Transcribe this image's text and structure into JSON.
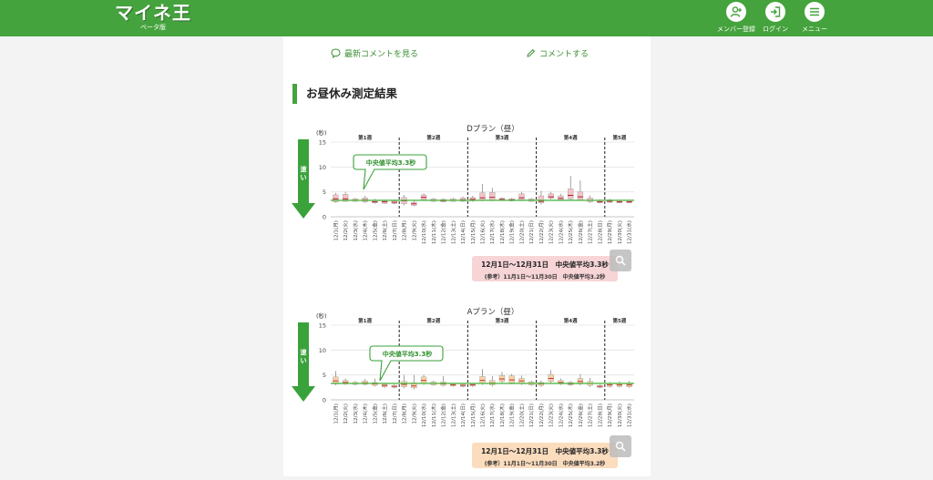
{
  "header": {
    "logo_text": "マイネ王",
    "logo_sub": "ベータ版",
    "nav": [
      {
        "label": "メンバー登録",
        "icon": "add-user-icon"
      },
      {
        "label": "ログイン",
        "icon": "login-icon"
      },
      {
        "label": "メニュー",
        "icon": "menu-icon"
      }
    ]
  },
  "links": {
    "view_comments": "最新コメントを見る",
    "write_comment": "コメントする"
  },
  "section_title": "お昼休み測定結果",
  "chart_data": [
    {
      "type": "boxplot",
      "title": "Dプラン（昼）",
      "ylabel": "(秒)",
      "ylim": [
        0,
        15
      ],
      "yticks": [
        "0",
        "5",
        "10",
        "15"
      ],
      "arrow_label": "速い",
      "week_labels": [
        "第1週",
        "第2週",
        "第3週",
        "第4週",
        "第5週"
      ],
      "median_line": 3.3,
      "callout": "中央値平均3.3秒",
      "categories": [
        "12/1(月)",
        "12/2(火)",
        "12/3(水)",
        "12/4(木)",
        "12/5(金)",
        "12/6(土)",
        "12/7(日)",
        "12/8(月)",
        "12/9(火)",
        "12/10(水)",
        "12/11(木)",
        "12/12(金)",
        "12/13(土)",
        "12/14(日)",
        "12/15(月)",
        "12/16(火)",
        "12/17(水)",
        "12/18(木)",
        "12/19(金)",
        "12/20(土)",
        "12/21(日)",
        "12/22(月)",
        "12/23(火)",
        "12/24(水)",
        "12/25(木)",
        "12/26(金)",
        "12/27(土)",
        "12/28(日)",
        "12/29(月)",
        "12/30(火)",
        "12/31(水)"
      ],
      "medians": [
        3.6,
        3.6,
        3.3,
        3.4,
        3.0,
        3.0,
        2.9,
        3.2,
        2.6,
        3.9,
        3.3,
        3.2,
        3.3,
        3.4,
        3.5,
        3.8,
        3.9,
        3.5,
        3.4,
        3.8,
        3.3,
        3.1,
        4.0,
        3.7,
        4.3,
        4.0,
        3.3,
        3.0,
        3.1,
        3.0,
        3.0
      ],
      "q1": [
        3.0,
        3.1,
        3.1,
        3.0,
        2.8,
        2.7,
        2.7,
        2.6,
        2.3,
        3.4,
        3.1,
        3.0,
        3.1,
        3.1,
        3.2,
        3.3,
        3.3,
        3.3,
        3.2,
        3.4,
        3.1,
        2.8,
        3.7,
        3.4,
        3.6,
        3.4,
        3.0,
        2.8,
        2.9,
        2.8,
        2.8
      ],
      "q3": [
        4.4,
        4.5,
        3.6,
        3.8,
        3.3,
        3.2,
        3.2,
        3.9,
        2.9,
        4.4,
        3.6,
        3.5,
        3.6,
        3.8,
        3.9,
        4.8,
        4.9,
        3.7,
        3.6,
        4.6,
        3.6,
        4.2,
        4.6,
        4.2,
        5.6,
        5.0,
        3.8,
        3.3,
        3.4,
        3.3,
        3.3
      ],
      "low": [
        2.8,
        3.0,
        3.0,
        2.8,
        2.6,
        2.6,
        2.5,
        2.3,
        2.1,
        3.2,
        3.0,
        2.9,
        3.0,
        3.0,
        3.0,
        3.1,
        3.1,
        3.2,
        3.1,
        3.2,
        3.0,
        2.5,
        3.5,
        3.3,
        3.3,
        3.2,
        2.8,
        2.7,
        2.8,
        2.7,
        2.7
      ],
      "high": [
        4.8,
        5.0,
        3.8,
        4.2,
        3.6,
        3.5,
        3.5,
        4.4,
        3.2,
        4.7,
        3.8,
        3.7,
        3.8,
        4.1,
        4.2,
        6.6,
        5.8,
        3.9,
        3.8,
        5.0,
        3.8,
        5.2,
        5.0,
        4.6,
        8.2,
        7.3,
        4.3,
        3.5,
        3.6,
        3.5,
        3.5
      ],
      "summary_line1": "12月1日～12月31日　中央値平均3.3秒",
      "summary_line2": "(参考）11月1日～11月30日　中央値平均3.2秒",
      "summary_color": "#f7d4d6",
      "box_color": "#f2c4c8",
      "median_color": "#b71c2b"
    },
    {
      "type": "boxplot",
      "title": "Aプラン（昼）",
      "ylabel": "(秒)",
      "ylim": [
        0,
        15
      ],
      "yticks": [
        "0",
        "5",
        "10",
        "15"
      ],
      "arrow_label": "速い",
      "week_labels": [
        "第1週",
        "第2週",
        "第3週",
        "第4週",
        "第5週"
      ],
      "median_line": 3.3,
      "callout": "中央値平均3.3秒",
      "categories": [
        "12/1(月)",
        "12/2(火)",
        "12/3(水)",
        "12/4(木)",
        "12/5(金)",
        "12/6(土)",
        "12/7(日)",
        "12/8(月)",
        "12/9(火)",
        "12/10(水)",
        "12/11(木)",
        "12/12(金)",
        "12/13(土)",
        "12/14(日)",
        "12/15(月)",
        "12/16(火)",
        "12/17(水)",
        "12/18(木)",
        "12/19(金)",
        "12/20(土)",
        "12/21(日)",
        "12/22(月)",
        "12/23(火)",
        "12/24(水)",
        "12/25(木)",
        "12/26(金)",
        "12/27(土)",
        "12/28(日)",
        "12/29(月)",
        "12/30(火)",
        "12/31(水)"
      ],
      "medians": [
        3.8,
        3.5,
        3.3,
        3.4,
        3.2,
        2.9,
        2.7,
        3.1,
        2.8,
        3.9,
        3.3,
        3.2,
        3.0,
        2.9,
        3.0,
        3.9,
        3.4,
        4.2,
        4.0,
        3.8,
        3.3,
        3.2,
        4.3,
        3.5,
        3.2,
        3.7,
        3.3,
        2.7,
        3.0,
        3.0,
        3.0
      ],
      "q1": [
        3.2,
        3.2,
        3.1,
        3.1,
        2.9,
        2.6,
        2.5,
        2.6,
        2.4,
        3.3,
        3.0,
        2.9,
        2.8,
        2.7,
        2.8,
        3.3,
        3.0,
        3.7,
        3.4,
        3.3,
        3.0,
        2.9,
        3.7,
        3.2,
        3.0,
        3.2,
        2.9,
        2.5,
        2.7,
        2.7,
        2.6
      ],
      "q3": [
        4.6,
        3.9,
        3.5,
        3.8,
        3.5,
        3.1,
        2.9,
        3.7,
        3.4,
        4.6,
        3.6,
        3.6,
        3.2,
        3.1,
        3.2,
        4.7,
        3.9,
        4.9,
        4.8,
        4.3,
        3.6,
        3.5,
        5.1,
        3.9,
        3.5,
        4.3,
        3.7,
        2.9,
        3.3,
        3.3,
        3.4
      ],
      "low": [
        2.9,
        3.0,
        2.9,
        2.9,
        2.7,
        2.4,
        2.3,
        2.3,
        2.1,
        3.0,
        2.8,
        2.7,
        2.6,
        2.5,
        2.6,
        3.0,
        2.7,
        3.3,
        3.1,
        3.0,
        2.8,
        2.6,
        3.3,
        3.0,
        2.8,
        2.9,
        2.6,
        2.3,
        2.5,
        2.5,
        2.4
      ],
      "high": [
        5.8,
        4.3,
        3.8,
        4.2,
        4.3,
        3.4,
        3.1,
        5.0,
        5.0,
        5.0,
        3.9,
        4.8,
        3.4,
        3.3,
        3.4,
        6.2,
        4.8,
        5.6,
        5.2,
        4.9,
        3.9,
        3.9,
        6.0,
        4.3,
        3.8,
        5.2,
        4.4,
        3.1,
        3.6,
        3.7,
        3.8
      ],
      "summary_line1": "12月1日～12月31日　中央値平均3.3秒",
      "summary_line2": "(参考）11月1日～11月30日　中央値平均3.2秒",
      "summary_color": "#fbdcbd",
      "box_color": "#f8d2a8",
      "median_color": "#c0392b"
    }
  ]
}
